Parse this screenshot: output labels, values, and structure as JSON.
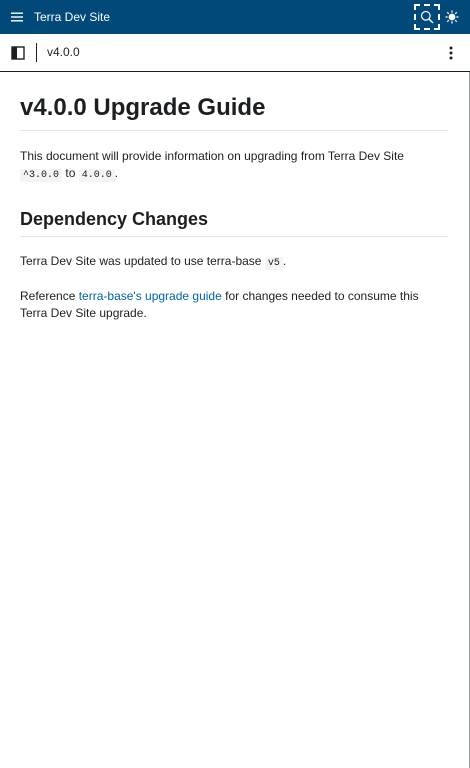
{
  "header": {
    "title": "Terra Dev Site",
    "icons": [
      "menu-icon",
      "search-icon",
      "theme-icon"
    ]
  },
  "toolbar": {
    "version": "v4.0.0",
    "icons": [
      "sidebar-toggle-icon",
      "more-vertical-icon"
    ]
  },
  "main": {
    "title": "v4.0.0 Upgrade Guide",
    "intro": {
      "text": "This document will provide information on upgrading from Terra Dev Site",
      "from_version": "^3.0.0",
      "to_word": "to",
      "to_version": "4.0.0",
      "end": "."
    },
    "section_title": "Dependency Changes",
    "dep_para": {
      "text": "Terra Dev Site was updated to use terra-base",
      "version": "v5",
      "end": "."
    },
    "ref_para": {
      "prefix": "Reference",
      "link_text": "terra-base's upgrade guide",
      "suffix": "for changes needed to consume this Terra Dev Site upgrade."
    }
  },
  "colors": {
    "header_bg": "#014979",
    "link": "#0065a3",
    "text": "#1c1f21"
  }
}
